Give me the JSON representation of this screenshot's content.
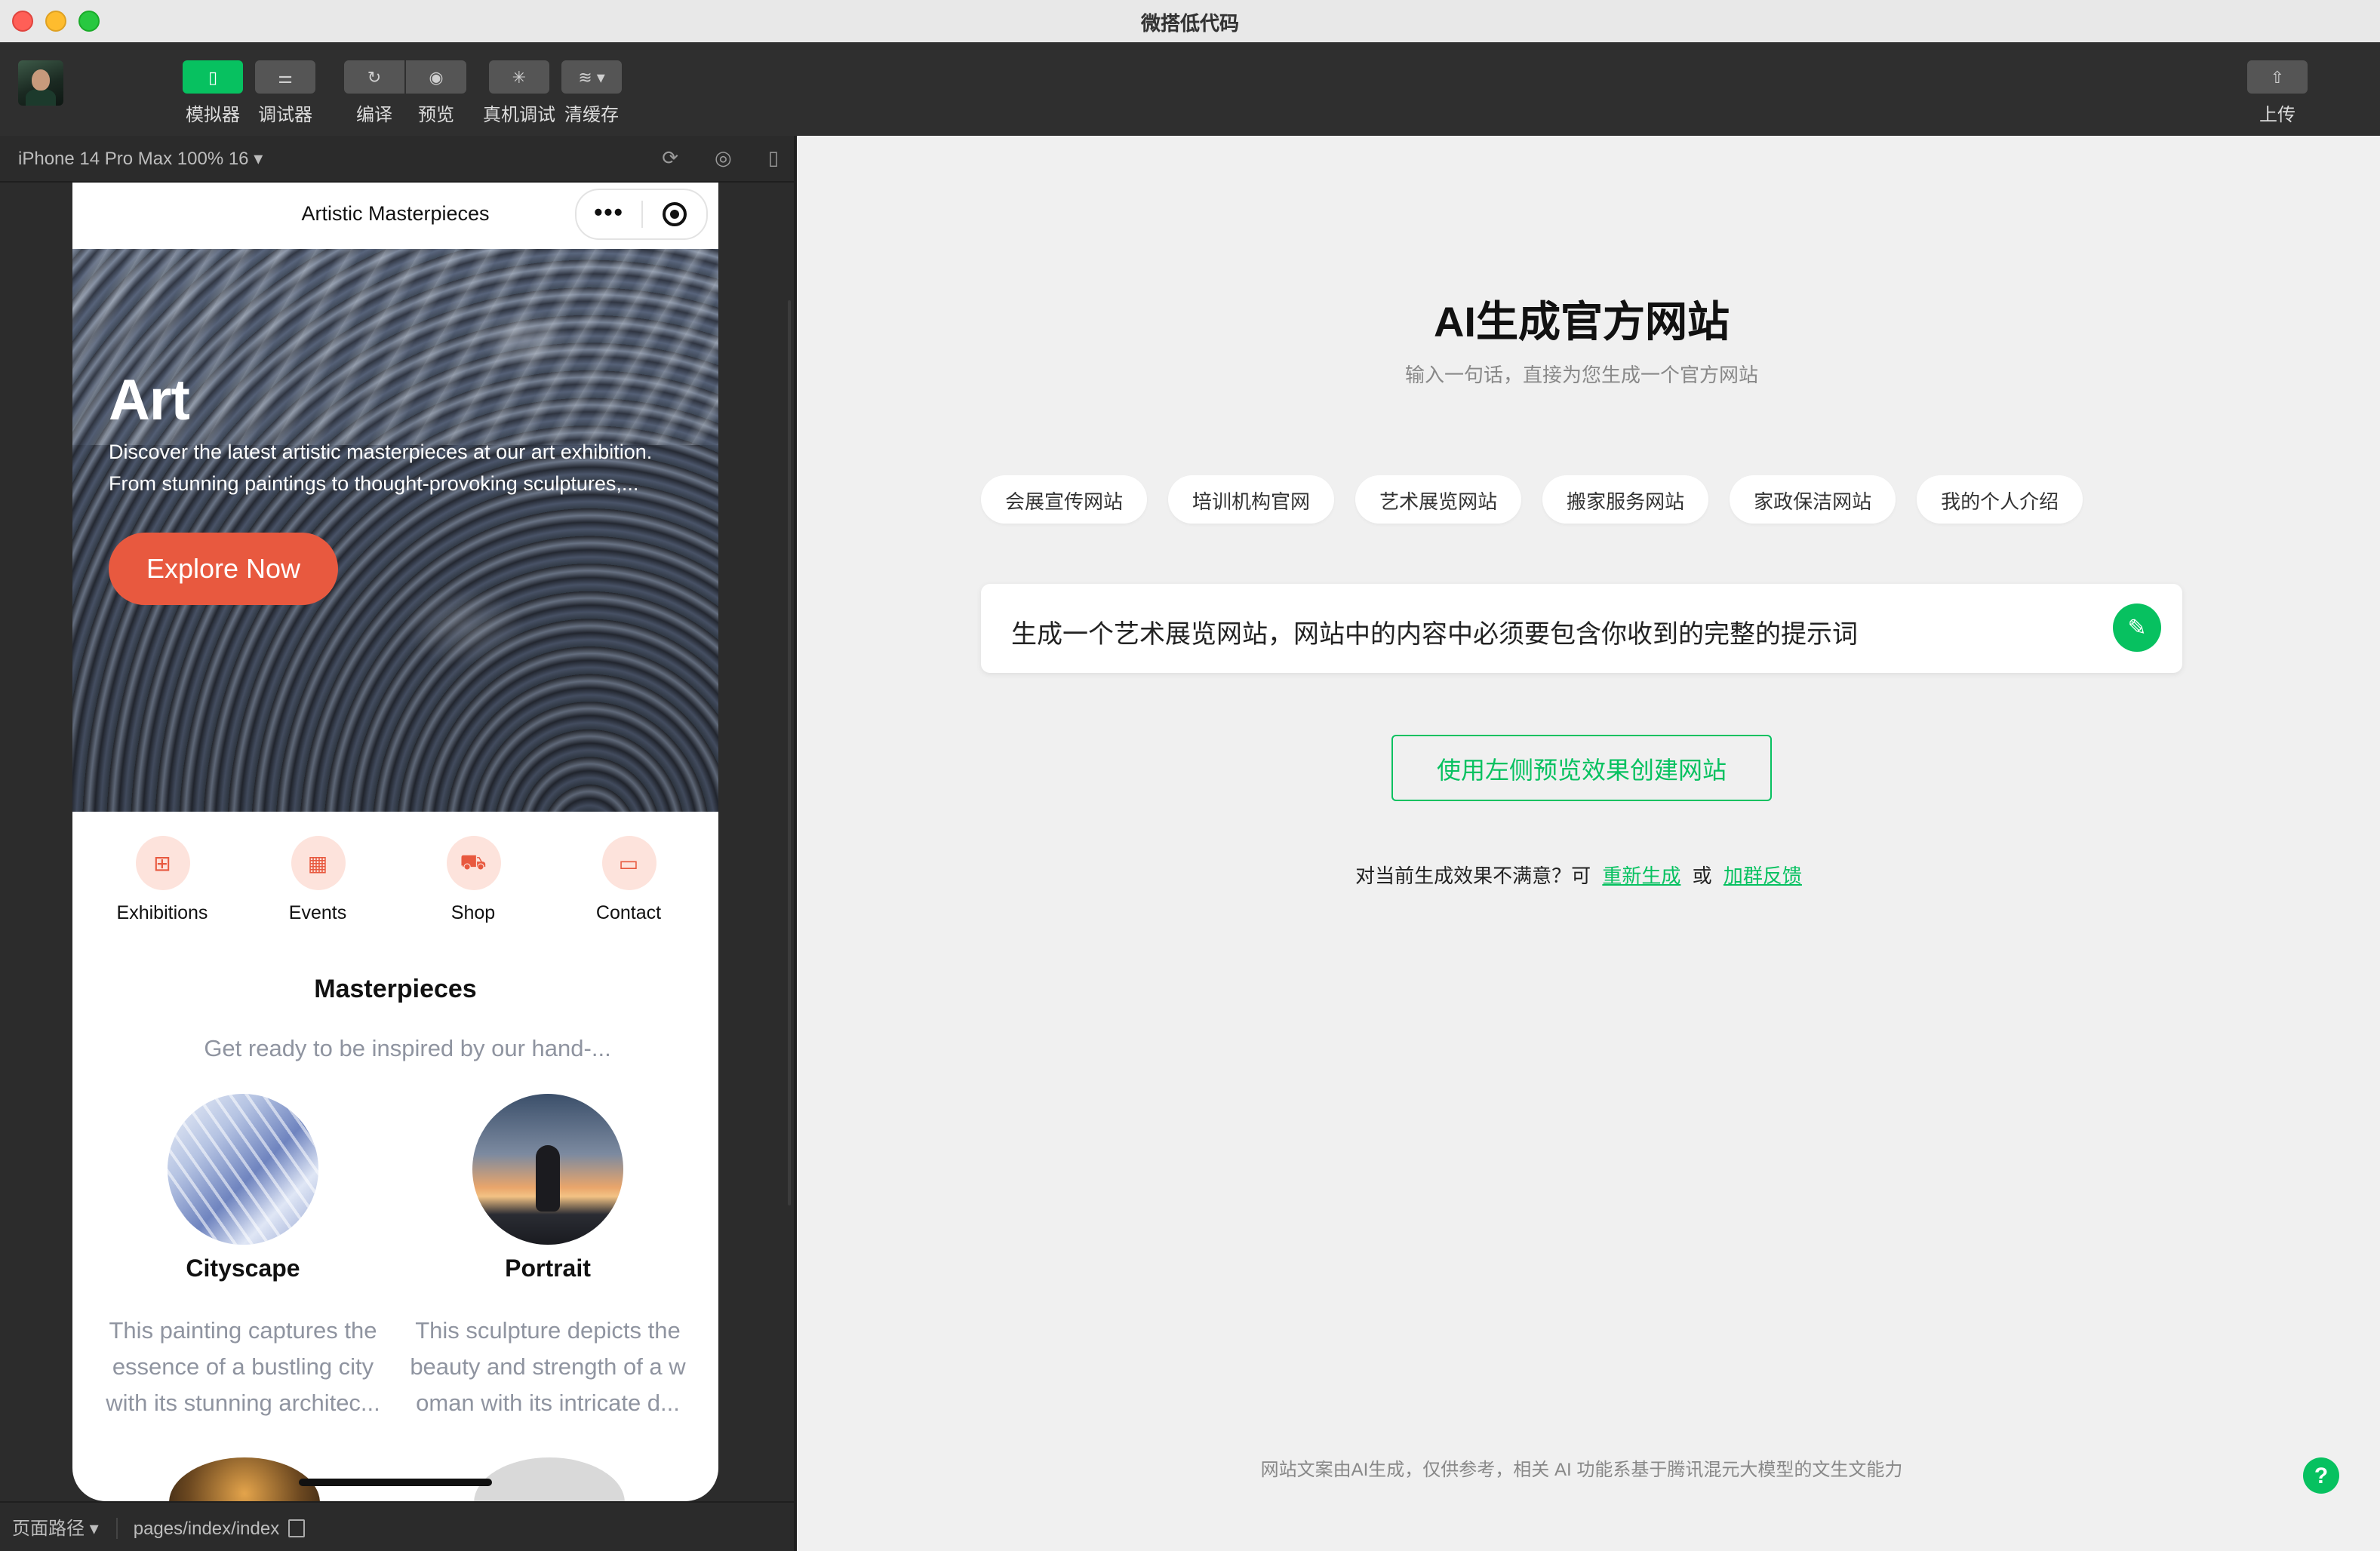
{
  "window": {
    "title": "微搭低代码"
  },
  "toolbar": {
    "buttons": [
      {
        "label": "模拟器",
        "icon": "phone-icon",
        "active": true
      },
      {
        "label": "调试器",
        "icon": "sliders-icon",
        "active": false
      },
      {
        "label": "编译",
        "icon": "refresh-icon",
        "active": false
      },
      {
        "label": "预览",
        "icon": "eye-icon",
        "active": false
      },
      {
        "label": "真机调试",
        "icon": "bug-icon",
        "active": false
      },
      {
        "label": "清缓存",
        "icon": "layers-icon",
        "active": false
      }
    ],
    "upload_label": "上传"
  },
  "simulator": {
    "device": "iPhone 14 Pro Max 100% 16 ▾",
    "footer": {
      "path_label": "页面路径 ▾",
      "path_value": "pages/index/index"
    }
  },
  "phone": {
    "nav_title": "Artistic Masterpieces",
    "hero": {
      "title": "Art",
      "desc_line1": "Discover the latest artistic masterpieces at our art exhibition.",
      "desc_line2": "From stunning paintings to thought-provoking sculptures,...",
      "button": "Explore Now"
    },
    "quicknav": [
      {
        "label": "Exhibitions",
        "icon": "grid-icon"
      },
      {
        "label": "Events",
        "icon": "calendar-icon"
      },
      {
        "label": "Shop",
        "icon": "cart-icon"
      },
      {
        "label": "Contact",
        "icon": "chat-icon"
      }
    ],
    "section": {
      "title": "Masterpieces",
      "subtitle": "Get ready to be inspired by our hand-..."
    },
    "cards": [
      {
        "name": "Cityscape",
        "desc": [
          "This painting captures the",
          "essence of a bustling city",
          "with its stunning architec..."
        ]
      },
      {
        "name": "Portrait",
        "desc": [
          "This sculpture depicts the",
          "beauty and strength of a w",
          "oman with its intricate d..."
        ]
      }
    ]
  },
  "panel": {
    "title": "AI生成官方网站",
    "subtitle": "输入一句话，直接为您生成一个官方网站",
    "chips": [
      "会展宣传网站",
      "培训机构官网",
      "艺术展览网站",
      "搬家服务网站",
      "家政保洁网站",
      "我的个人介绍"
    ],
    "prompt_value": "生成一个艺术展览网站，网站中的内容中必须要包含你收到的完整的提示词",
    "create_button": "使用左侧预览效果创建网站",
    "feedback_prefix": "对当前生成效果不满意？可",
    "feedback_regen": "重新生成",
    "feedback_or": "或",
    "feedback_group": "加群反馈",
    "footnote": "网站文案由AI生成，仅供参考，相关 AI 功能系基于腾讯混元大模型的文生文能力",
    "help": "?"
  },
  "colors": {
    "accent": "#07c160",
    "hero_button": "#e8593f",
    "quicknav_bg": "#fde3dc"
  }
}
